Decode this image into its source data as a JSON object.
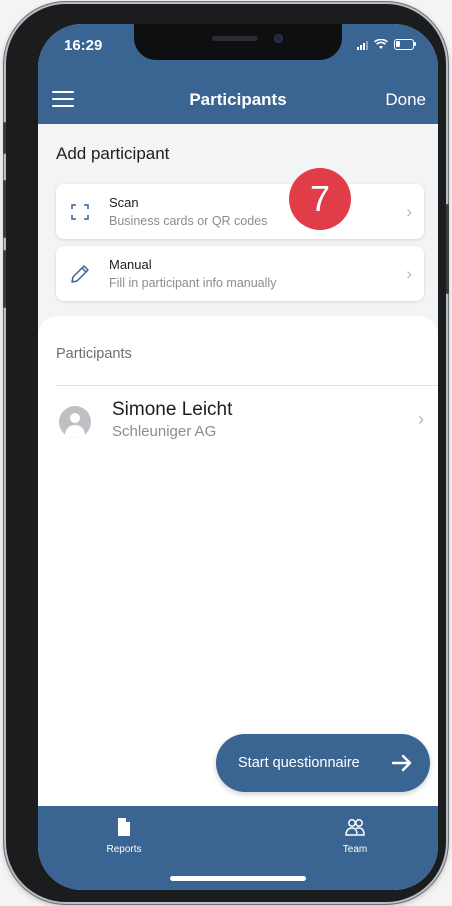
{
  "status_bar": {
    "time": "16:29"
  },
  "nav": {
    "title": "Participants",
    "done_label": "Done"
  },
  "add_section": {
    "title": "Add participant",
    "options": [
      {
        "title": "Scan",
        "subtitle": "Business cards or QR codes",
        "icon": "scan-frame-icon"
      },
      {
        "title": "Manual",
        "subtitle": "Fill in participant info manually",
        "icon": "pencil-icon"
      }
    ]
  },
  "step_badge": "7",
  "participants": {
    "title": "Participants",
    "items": [
      {
        "name": "Simone Leicht",
        "company": "Schleuniger AG"
      }
    ]
  },
  "start_button": {
    "label": "Start questionnaire"
  },
  "tab_bar": {
    "tabs": [
      {
        "label": "Reports",
        "icon": "document-icon"
      },
      {
        "label": "Team",
        "icon": "people-icon"
      }
    ]
  },
  "colors": {
    "primary": "#3a6592",
    "badge": "#e13d49",
    "background": "#f3f4f6"
  }
}
